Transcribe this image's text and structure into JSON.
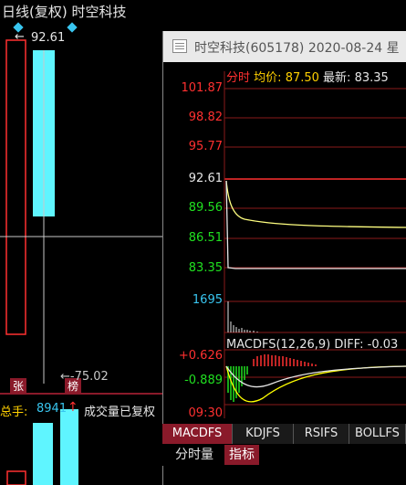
{
  "left_panel": {
    "title": "日线(复权) 时空科技",
    "high_price_marker": "←",
    "high_price": "92.61",
    "low_price_label": "←-75.02",
    "badge_zhang": "张",
    "badge_bang": "榜",
    "volume_label": "总手:",
    "volume_value": "8941",
    "volume_arrow": "↑",
    "volume_note": "成交量已复权"
  },
  "popup": {
    "title": "时空科技(605178) 2020-08-24 星",
    "info": {
      "mode": "分时",
      "avg_label": "均价:",
      "avg_value": "87.50",
      "latest_label": "最新:",
      "latest_value": "83.35"
    },
    "price_axis": [
      "101.87",
      "98.82",
      "95.77",
      "92.61",
      "89.56",
      "86.51",
      "83.35"
    ],
    "volume_axis": "1695",
    "macd_axis": [
      "+0.626",
      "-0.889"
    ],
    "time_label": "09:30",
    "macd_label": "MACDFS(12,26,9) DIFF: -0.03"
  },
  "tabs": [
    "MACDFS",
    "KDJFS",
    "RSIFS",
    "BOLLFS"
  ],
  "subtabs": [
    "分时量",
    "指标"
  ],
  "colors": {
    "up": "#ff3030",
    "down": "#20e020",
    "candle": "#5ff5ff",
    "price_line": "#ffffff",
    "avg_line": "#ffff80"
  }
}
